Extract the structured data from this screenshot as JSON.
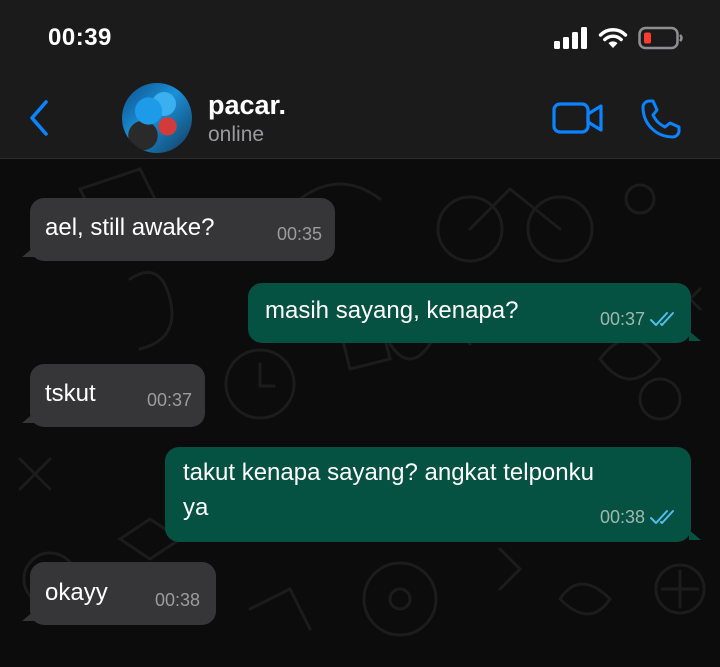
{
  "status_bar": {
    "time": "00:39",
    "icons": [
      "signal-icon",
      "wifi-icon",
      "battery-low-icon"
    ],
    "battery_color": "#ff3b30"
  },
  "header": {
    "contact_name": "pacar.",
    "contact_status": "online",
    "accent_color": "#0a84ff"
  },
  "messages": [
    {
      "direction": "incoming",
      "text": "ael, still awake?",
      "time": "00:35"
    },
    {
      "direction": "outgoing",
      "text": "masih sayang, kenapa?",
      "time": "00:37",
      "read": true
    },
    {
      "direction": "incoming",
      "text": "tskut",
      "time": "00:37"
    },
    {
      "direction": "outgoing",
      "text_line1": "takut kenapa sayang? angkat telponku",
      "text_line2": "ya",
      "time": "00:38",
      "read": true
    },
    {
      "direction": "incoming",
      "text": "okayy",
      "time": "00:38"
    }
  ],
  "colors": {
    "incoming_bubble": "#363638",
    "outgoing_bubble": "#055242",
    "read_ticks": "#53bdeb"
  }
}
